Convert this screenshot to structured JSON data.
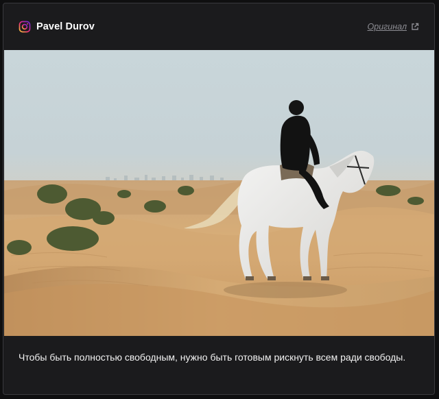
{
  "post": {
    "author": "Pavel Durov",
    "author_icon": "instagram-icon",
    "original_link_label": "Оригинал",
    "original_link_icon": "external-link-icon",
    "caption": "Чтобы быть полностью свободным, нужно быть готовым рискнуть всем ради свободы."
  },
  "colors": {
    "card_background": "#1b1b1d",
    "text": "#ffffff",
    "muted_link": "#8d8d93"
  }
}
